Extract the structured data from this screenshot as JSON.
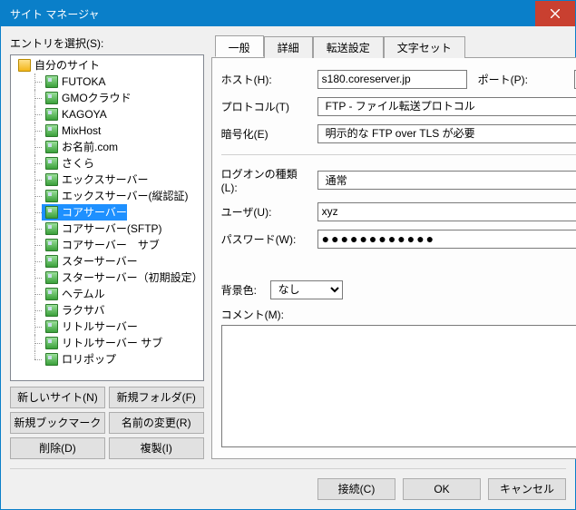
{
  "title": "サイト マネージャ",
  "select_label": "エントリを選択(S):",
  "tree": {
    "root": "自分のサイト",
    "items": [
      "FUTOKA",
      "GMOクラウド",
      "KAGOYA",
      "MixHost",
      "お名前.com",
      "さくら",
      "エックスサーバー",
      "エックスサーバー(縦認証)",
      "コアサーバー",
      "コアサーバー(SFTP)",
      "コアサーバー　サブ",
      "スターサーバー",
      "スターサーバー（初期設定）",
      "ヘテムル",
      "ラクサバ",
      "リトルサーバー",
      "リトルサーバー サブ",
      "ロリポップ"
    ],
    "selected_index": 8
  },
  "left_buttons": {
    "new_site": "新しいサイト(N)",
    "new_folder": "新規フォルダ(F)",
    "new_bookmark": "新規ブックマーク(M)",
    "rename": "名前の変更(R)",
    "delete": "削除(D)",
    "duplicate": "複製(I)"
  },
  "tabs": [
    "一般",
    "詳細",
    "転送設定",
    "文字セット"
  ],
  "active_tab": 0,
  "form": {
    "host_label": "ホスト(H):",
    "host_value": "s180.coreserver.jp",
    "port_label": "ポート(P):",
    "port_value": "",
    "protocol_label": "プロトコル(T)",
    "protocol_value": "FTP - ファイル転送プロトコル",
    "encryption_label": "暗号化(E)",
    "encryption_value": "明示的な FTP over TLS が必要",
    "logon_label": "ログオンの種類(L):",
    "logon_value": "通常",
    "user_label": "ユーザ(U):",
    "user_value": "xyz",
    "password_label": "パスワード(W):",
    "password_value": "●●●●●●●●●●●●",
    "bgcolor_label": "背景色:",
    "bgcolor_value": "なし",
    "comment_label": "コメント(M):",
    "comment_value": ""
  },
  "footer": {
    "connect": "接続(C)",
    "ok": "OK",
    "cancel": "キャンセル"
  }
}
